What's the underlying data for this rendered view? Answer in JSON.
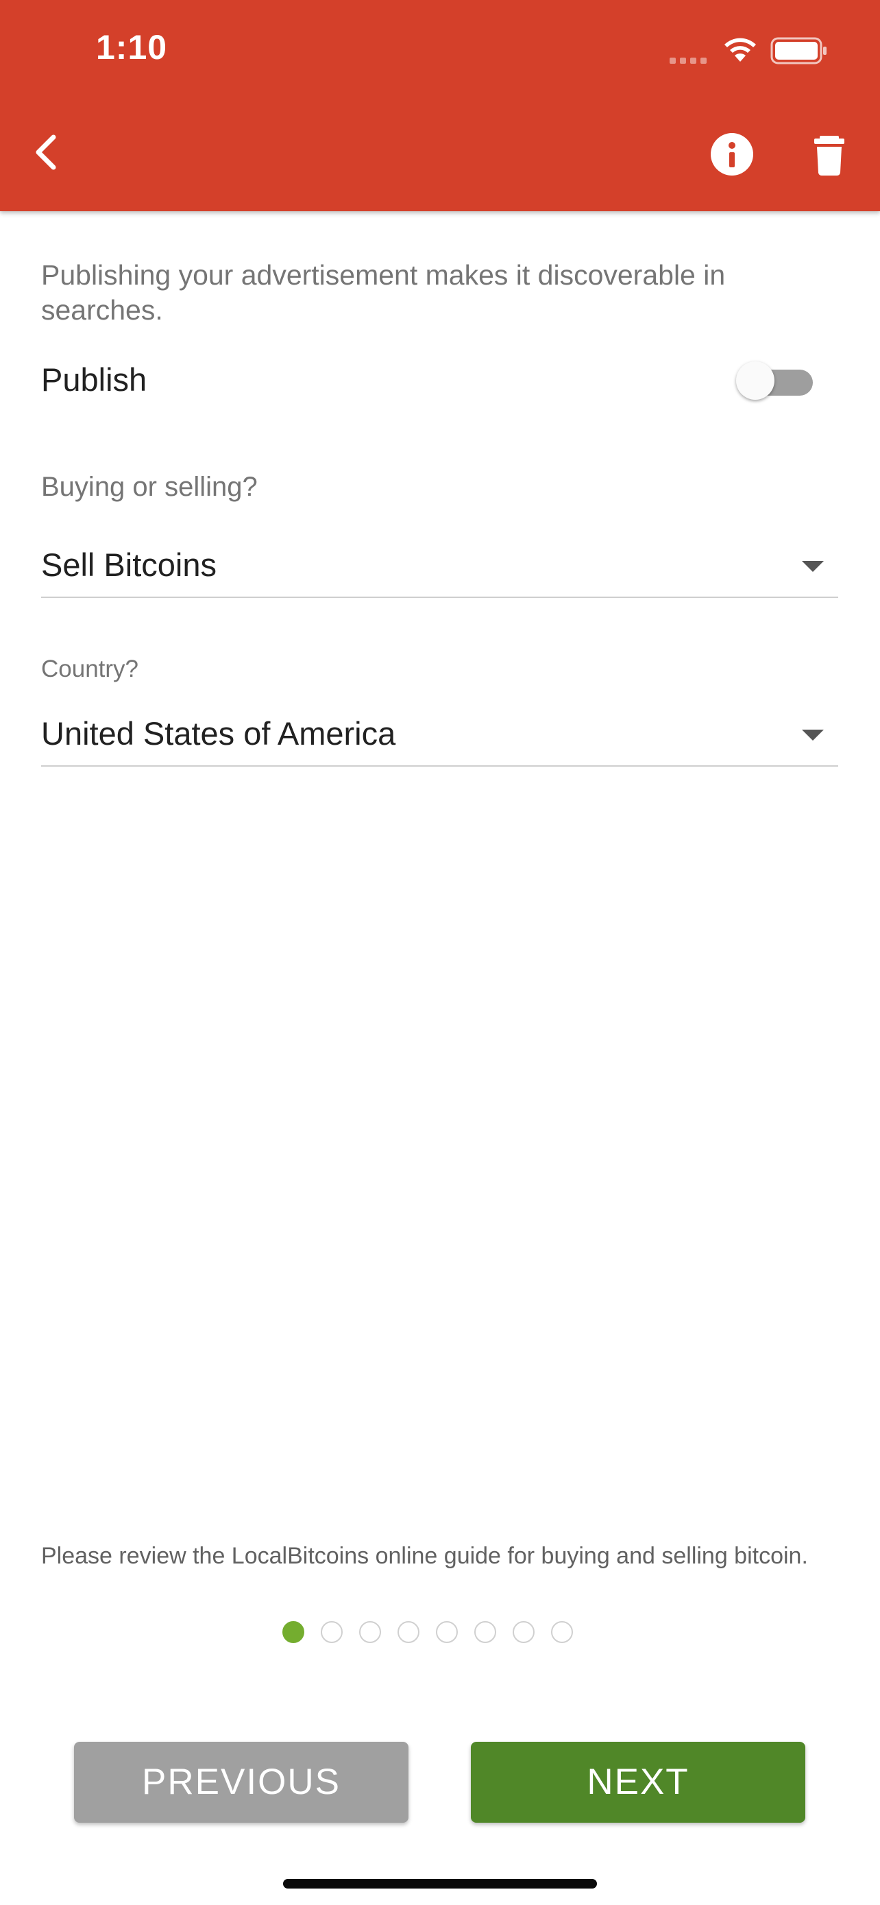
{
  "status_bar": {
    "time": "1:10"
  },
  "header": {
    "background_color": "#d4402a",
    "back_icon": "chevron-left-icon",
    "info_icon": "info-circle-icon",
    "delete_icon": "trash-icon"
  },
  "publish": {
    "description": "Publishing your advertisement makes it discoverable in searches.",
    "label": "Publish",
    "enabled": false
  },
  "trade_type": {
    "label": "Buying or selling?",
    "value": "Sell Bitcoins"
  },
  "country": {
    "label": "Country?",
    "value": "United States of America"
  },
  "guide": {
    "text": "Please review the LocalBitcoins online guide for buying and selling bitcoin."
  },
  "stepper": {
    "total_steps": 8,
    "current_step": 1,
    "active_color": "#74ad2f"
  },
  "buttons": {
    "previous_label": "PREVIOUS",
    "next_label": "NEXT",
    "next_color": "#508728"
  }
}
